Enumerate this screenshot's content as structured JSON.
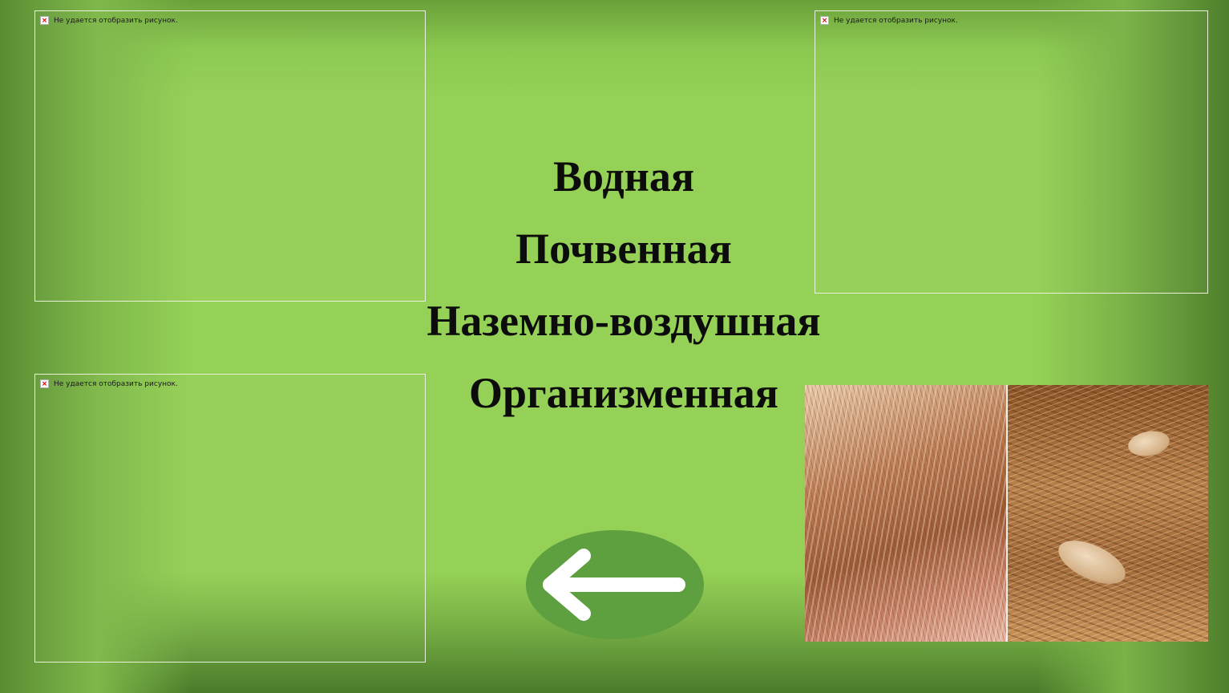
{
  "slide": {
    "broken_image_text": "Не удается отобразить рисунок.",
    "habitats": [
      "Водная",
      "Почвенная",
      "Наземно-воздушная",
      "Организменная"
    ],
    "photo_alt": "hair-with-lice-photo",
    "back_button_icon": "arrow-left-icon",
    "colors": {
      "background": "#95d156",
      "text": "#0c0c0c",
      "button": "#5e9f3f",
      "arrow": "#ffffff"
    }
  }
}
